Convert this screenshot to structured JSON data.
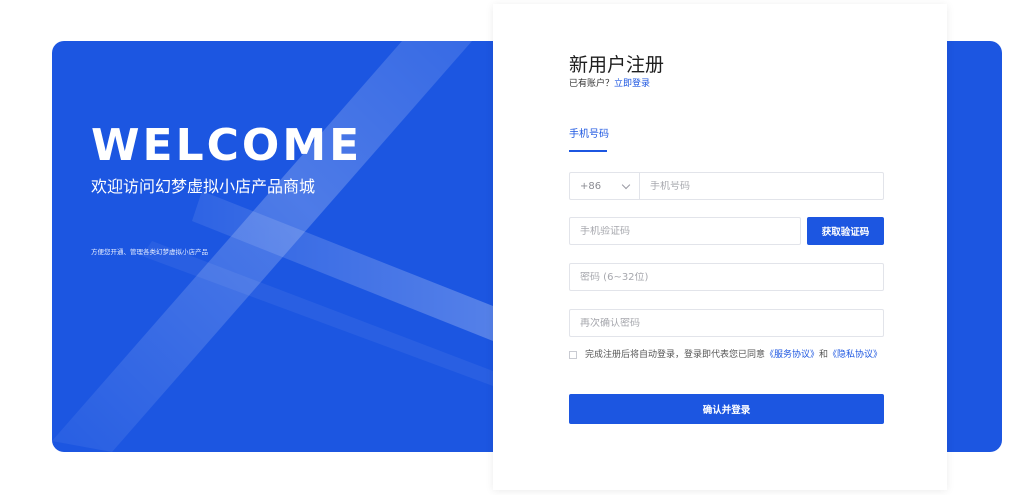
{
  "banner": {
    "heading": "WELCOME",
    "subheading": "欢迎访问幻梦虚拟小店产品商城",
    "note": "方便您开通、管理各类幻梦虚拟小店产品",
    "background_color": "#1c56e1"
  },
  "form": {
    "title": "新用户注册",
    "have_account_text": "已有账户？",
    "login_link": "立即登录",
    "tabs": [
      {
        "label": "手机号码",
        "active": true
      }
    ],
    "country_code": "+86",
    "phone_placeholder": "手机号码",
    "sms_code_placeholder": "手机验证码",
    "get_code_button": "获取验证码",
    "password_placeholder": "密码 (6~32位)",
    "confirm_password_placeholder": "再次确认密码",
    "agreement": {
      "prefix": "完成注册后将自动登录，登录即代表您已同意",
      "service_link": "《服务协议》",
      "and": "和",
      "privacy_link": "《隐私协议》",
      "checked": false
    },
    "submit_button": "确认并登录",
    "accent_color": "#1c56e1"
  }
}
